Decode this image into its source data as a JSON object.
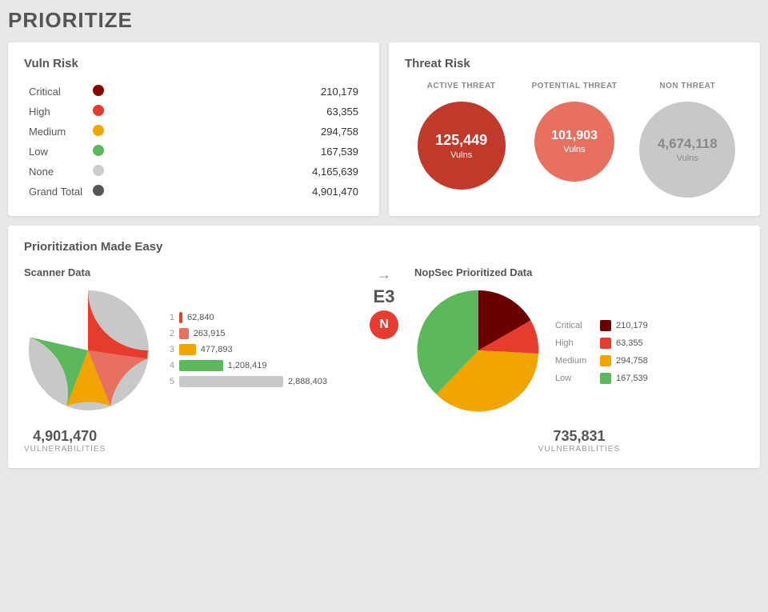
{
  "page": {
    "title": "PRIORITIZE"
  },
  "vuln_risk": {
    "title": "Vuln Risk",
    "rows": [
      {
        "label": "Critical",
        "dot_class": "dot-critical",
        "value": "210,179"
      },
      {
        "label": "High",
        "dot_class": "dot-high",
        "value": "63,355"
      },
      {
        "label": "Medium",
        "dot_class": "dot-medium",
        "value": "294,758"
      },
      {
        "label": "Low",
        "dot_class": "dot-low",
        "value": "167,539"
      },
      {
        "label": "None",
        "dot_class": "dot-none",
        "value": "4,165,639"
      },
      {
        "label": "Grand Total",
        "dot_class": "dot-total",
        "value": "4,901,470"
      }
    ]
  },
  "threat_risk": {
    "title": "Threat Risk",
    "columns": [
      {
        "header": "ACTIVE THREAT",
        "value": "125,449",
        "label": "Vulns",
        "size": "active"
      },
      {
        "header": "POTENTIAL THREAT",
        "value": "101,903",
        "label": "Vulns",
        "size": "potential"
      },
      {
        "header": "NON THREAT",
        "value": "4,674,118",
        "label": "Vulns",
        "size": "non"
      }
    ]
  },
  "prioritization": {
    "section_title": "Prioritization Made Easy",
    "scanner": {
      "subtitle": "Scanner Data",
      "bars": [
        {
          "rank": "1",
          "value": "62,840",
          "color": "#e53c2e",
          "pct": 2
        },
        {
          "rank": "2",
          "value": "263,915",
          "color": "#e87060",
          "pct": 9
        },
        {
          "rank": "3",
          "value": "477,893",
          "color": "#f0a500",
          "pct": 16
        },
        {
          "rank": "4",
          "value": "1,208,419",
          "color": "#5cb85c",
          "pct": 42
        },
        {
          "rank": "5",
          "value": "2,888,403",
          "color": "#c8c8c8",
          "pct": 100
        }
      ],
      "footer_number": "4,901,470",
      "footer_label": "VULNERABILITIES"
    },
    "arrow": "→",
    "e3_label": "E3",
    "nopsec_logo": "N",
    "nopsec": {
      "subtitle": "NopSec Prioritized Data",
      "legend": [
        {
          "label": "Critical",
          "color": "#6b0000",
          "value": "210,179"
        },
        {
          "label": "High",
          "color": "#e53c2e",
          "value": "63,355"
        },
        {
          "label": "Medium",
          "color": "#f0a500",
          "value": "294,758"
        },
        {
          "label": "Low",
          "color": "#5cb85c",
          "value": "167,539"
        }
      ],
      "footer_number": "735,831",
      "footer_label": "VULNERABILITIES"
    }
  }
}
